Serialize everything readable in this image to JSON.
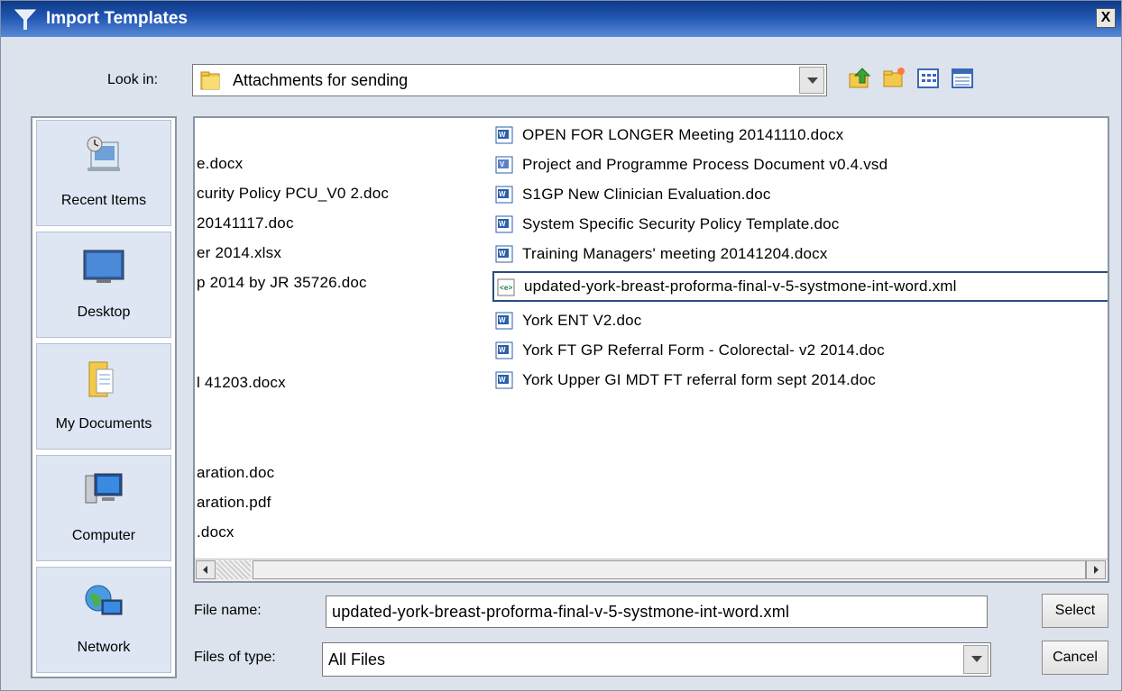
{
  "window": {
    "title": "Import Templates",
    "close_label": "X"
  },
  "look_in": {
    "label": "Look in:",
    "value": "Attachments for sending"
  },
  "toolbar": {
    "icons": [
      "up-folder-icon",
      "new-folder-icon",
      "list-view-icon",
      "details-view-icon"
    ]
  },
  "places": [
    {
      "label": "Recent Items",
      "icon": "recent-items-icon"
    },
    {
      "label": "Desktop",
      "icon": "desktop-icon"
    },
    {
      "label": "My Documents",
      "icon": "my-documents-icon"
    },
    {
      "label": "Computer",
      "icon": "computer-icon"
    },
    {
      "label": "Network",
      "icon": "network-icon"
    }
  ],
  "files_left_column": [
    "e.docx",
    "curity Policy PCU_V0 2.doc",
    "20141117.doc",
    "er 2014.xlsx",
    "p 2014 by JR 35726.doc",
    "l 41203.docx",
    "aration.doc",
    "aration.pdf",
    ".docx"
  ],
  "files_right_column": [
    {
      "name": "OPEN FOR LONGER Meeting 20141110.docx",
      "icon": "word-doc-icon"
    },
    {
      "name": "Project and Programme Process Document v0.4.vsd",
      "icon": "visio-doc-icon"
    },
    {
      "name": "S1GP New Clinician Evaluation.doc",
      "icon": "word-doc-icon"
    },
    {
      "name": "System Specific Security Policy Template.doc",
      "icon": "word-doc-icon"
    },
    {
      "name": "Training Managers' meeting 20141204.docx",
      "icon": "word-doc-icon"
    },
    {
      "name": "updated-york-breast-proforma-final-v-5-systmone-int-word.xml",
      "icon": "xml-file-icon",
      "selected": true
    },
    {
      "name": "York ENT V2.doc",
      "icon": "word-doc-icon"
    },
    {
      "name": "York FT GP Referral Form - Colorectal- v2 2014.doc",
      "icon": "word-doc-icon"
    },
    {
      "name": "York Upper GI MDT FT referral form sept 2014.doc",
      "icon": "word-doc-icon"
    }
  ],
  "file_name": {
    "label": "File name:",
    "value": "updated-york-breast-proforma-final-v-5-systmone-int-word.xml"
  },
  "files_of_type": {
    "label": "Files of type:",
    "value": "All Files"
  },
  "buttons": {
    "select": "Select",
    "cancel": "Cancel"
  }
}
